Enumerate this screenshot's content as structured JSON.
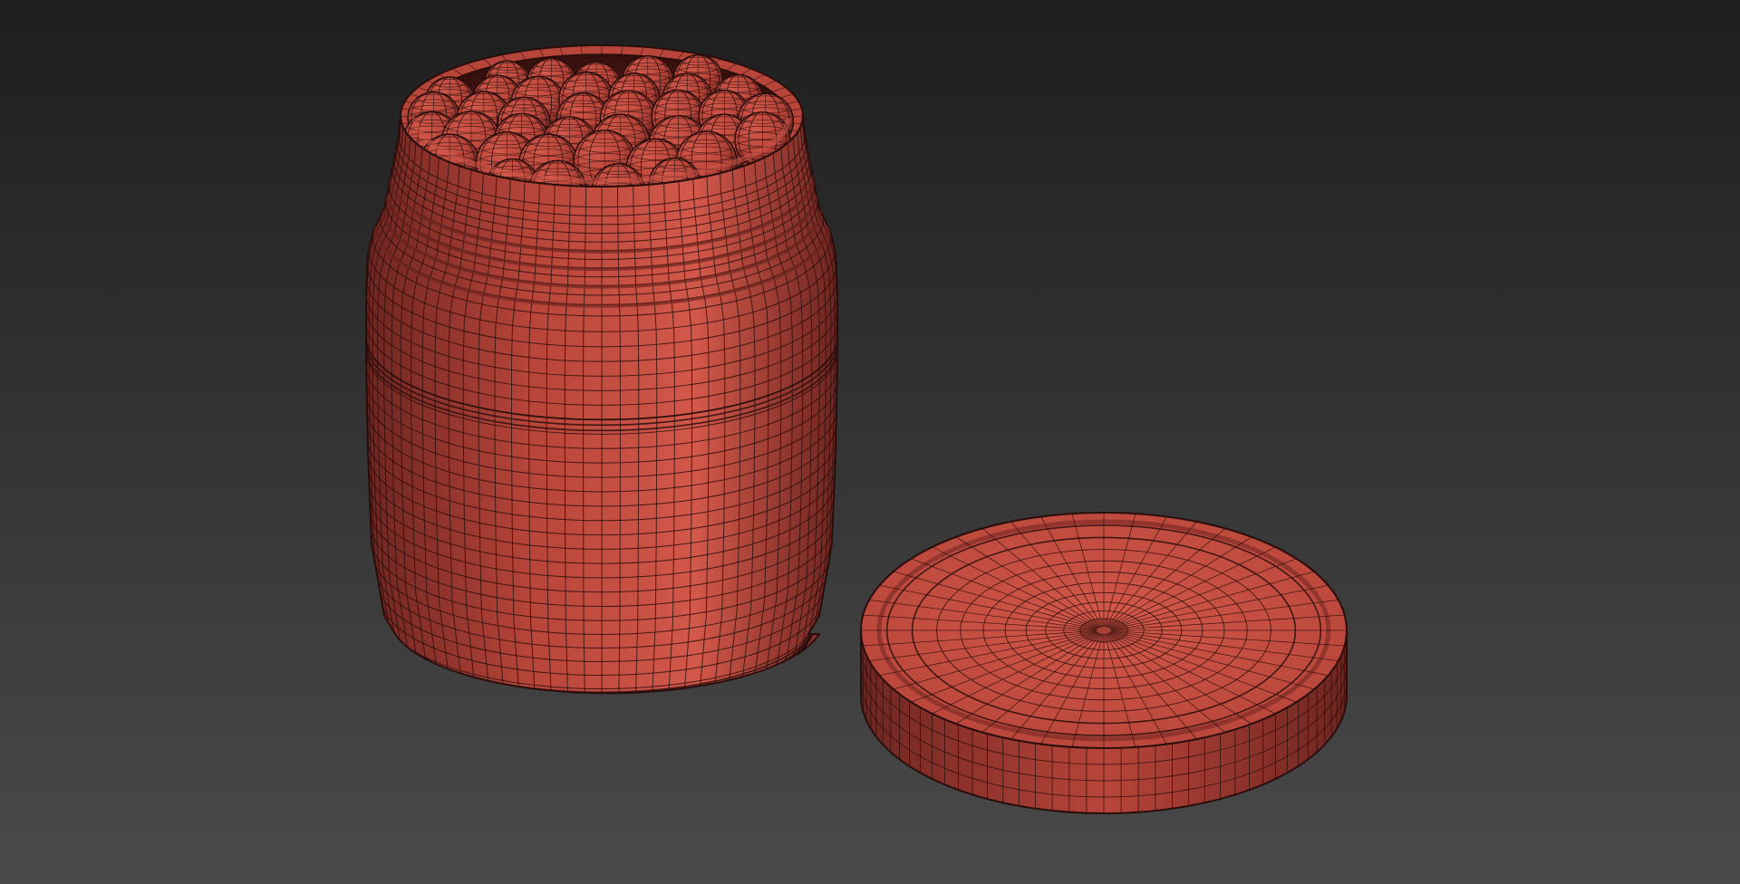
{
  "viewport": {
    "background_top": "#1e1e1e",
    "background_bottom": "#4a4a4a",
    "model_color": "#b8453a",
    "model_light": "#d2584a",
    "model_dark": "#6e2520",
    "wire_color": "#2a0e0c"
  },
  "scene": {
    "objects": [
      {
        "name": "jar",
        "icon": "jar-icon"
      },
      {
        "name": "jar-lid",
        "icon": "lid-icon"
      },
      {
        "name": "spheres",
        "icon": "sphere-icon"
      }
    ],
    "sphere_count": 36,
    "jar_vertical_segments": 40,
    "jar_horizontal_rings": 28,
    "lid_radial_segments": 48,
    "lid_rings": 12
  }
}
